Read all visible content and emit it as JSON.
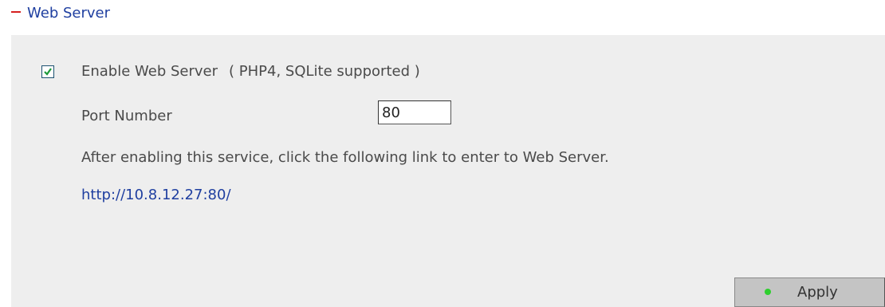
{
  "section": {
    "title": "Web Server",
    "collapse_icon": "minus-icon",
    "collapse_color": "#d62020"
  },
  "form": {
    "enable_checked": true,
    "enable_label": "Enable Web Server",
    "enable_note": "( PHP4, SQLite supported )",
    "port_label": "Port Number",
    "port_value": "80",
    "help_text": "After enabling this service, click the following link to enter to Web Server.",
    "server_link": "http://10.8.12.27:80/"
  },
  "actions": {
    "apply_label": "Apply",
    "apply_icon": "green-dot-icon",
    "apply_dot_color": "#2fcf2f"
  },
  "colors": {
    "title_blue": "#1f3fa0",
    "panel_bg": "#eeeeee",
    "button_bg": "#c4c4c4"
  }
}
